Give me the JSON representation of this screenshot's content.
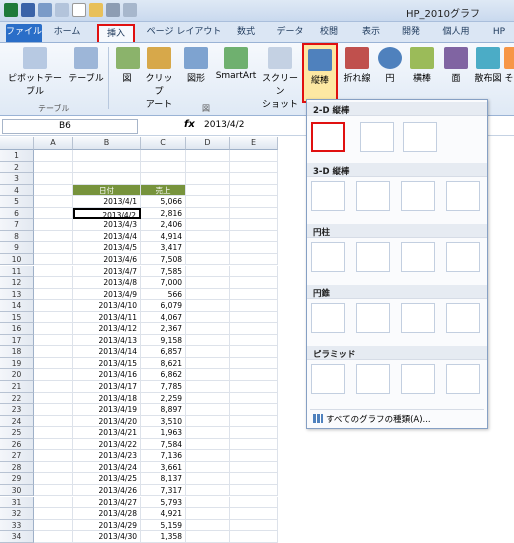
{
  "title": "HP_2010グラフ",
  "tabs": [
    "ファイル",
    "ホーム",
    "挿入",
    "ページ レイアウト",
    "数式",
    "データ",
    "校閲",
    "表示",
    "開発",
    "個人用",
    "HP"
  ],
  "ribbon": {
    "pivot": "ピボットテーブル",
    "table": "テーブル",
    "group_table": "テーブル",
    "picture": "図",
    "clipart": "クリップ\nアート",
    "shapes": "図形",
    "smartart": "SmartArt",
    "screenshot": "スクリーン\nショット",
    "group_fig": "図",
    "bar": "縦棒",
    "line": "折れ線",
    "pie": "円",
    "hbar": "横棒",
    "area": "面",
    "scatter": "散布図",
    "other": "そ"
  },
  "formula": {
    "name": "B6",
    "fx": "fx",
    "value": "2013/4/2"
  },
  "columns": [
    "A",
    "B",
    "C",
    "D",
    "E"
  ],
  "rows": [
    1,
    2,
    3,
    4,
    5,
    6,
    7,
    8,
    9,
    10,
    11,
    12,
    13,
    14,
    15,
    16,
    17,
    18,
    19,
    20,
    21,
    22,
    23,
    24,
    25,
    26,
    27,
    28,
    29,
    30,
    31,
    32,
    33,
    34
  ],
  "table": {
    "header": [
      "日付",
      "売上"
    ],
    "data": [
      [
        "2013/4/1",
        "5,066"
      ],
      [
        "2013/4/2",
        "2,816"
      ],
      [
        "2013/4/3",
        "2,406"
      ],
      [
        "2013/4/4",
        "4,914"
      ],
      [
        "2013/4/5",
        "3,417"
      ],
      [
        "2013/4/6",
        "7,508"
      ],
      [
        "2013/4/7",
        "7,585"
      ],
      [
        "2013/4/8",
        "7,000"
      ],
      [
        "2013/4/9",
        "566"
      ],
      [
        "2013/4/10",
        "6,079"
      ],
      [
        "2013/4/11",
        "4,067"
      ],
      [
        "2013/4/12",
        "2,367"
      ],
      [
        "2013/4/13",
        "9,158"
      ],
      [
        "2013/4/14",
        "6,857"
      ],
      [
        "2013/4/15",
        "8,621"
      ],
      [
        "2013/4/16",
        "6,862"
      ],
      [
        "2013/4/17",
        "7,785"
      ],
      [
        "2013/4/18",
        "2,259"
      ],
      [
        "2013/4/19",
        "8,897"
      ],
      [
        "2013/4/20",
        "3,510"
      ],
      [
        "2013/4/21",
        "1,963"
      ],
      [
        "2013/4/22",
        "7,584"
      ],
      [
        "2013/4/23",
        "7,136"
      ],
      [
        "2013/4/24",
        "3,661"
      ],
      [
        "2013/4/25",
        "8,137"
      ],
      [
        "2013/4/26",
        "7,317"
      ],
      [
        "2013/4/27",
        "5,793"
      ],
      [
        "2013/4/28",
        "4,921"
      ],
      [
        "2013/4/29",
        "5,159"
      ],
      [
        "2013/4/30",
        "1,358"
      ]
    ]
  },
  "gallery": {
    "sections": [
      "2-D 縦棒",
      "3-D 縦棒",
      "円柱",
      "円錐",
      "ピラミッド"
    ],
    "footer": "すべてのグラフの種類(A)..."
  }
}
